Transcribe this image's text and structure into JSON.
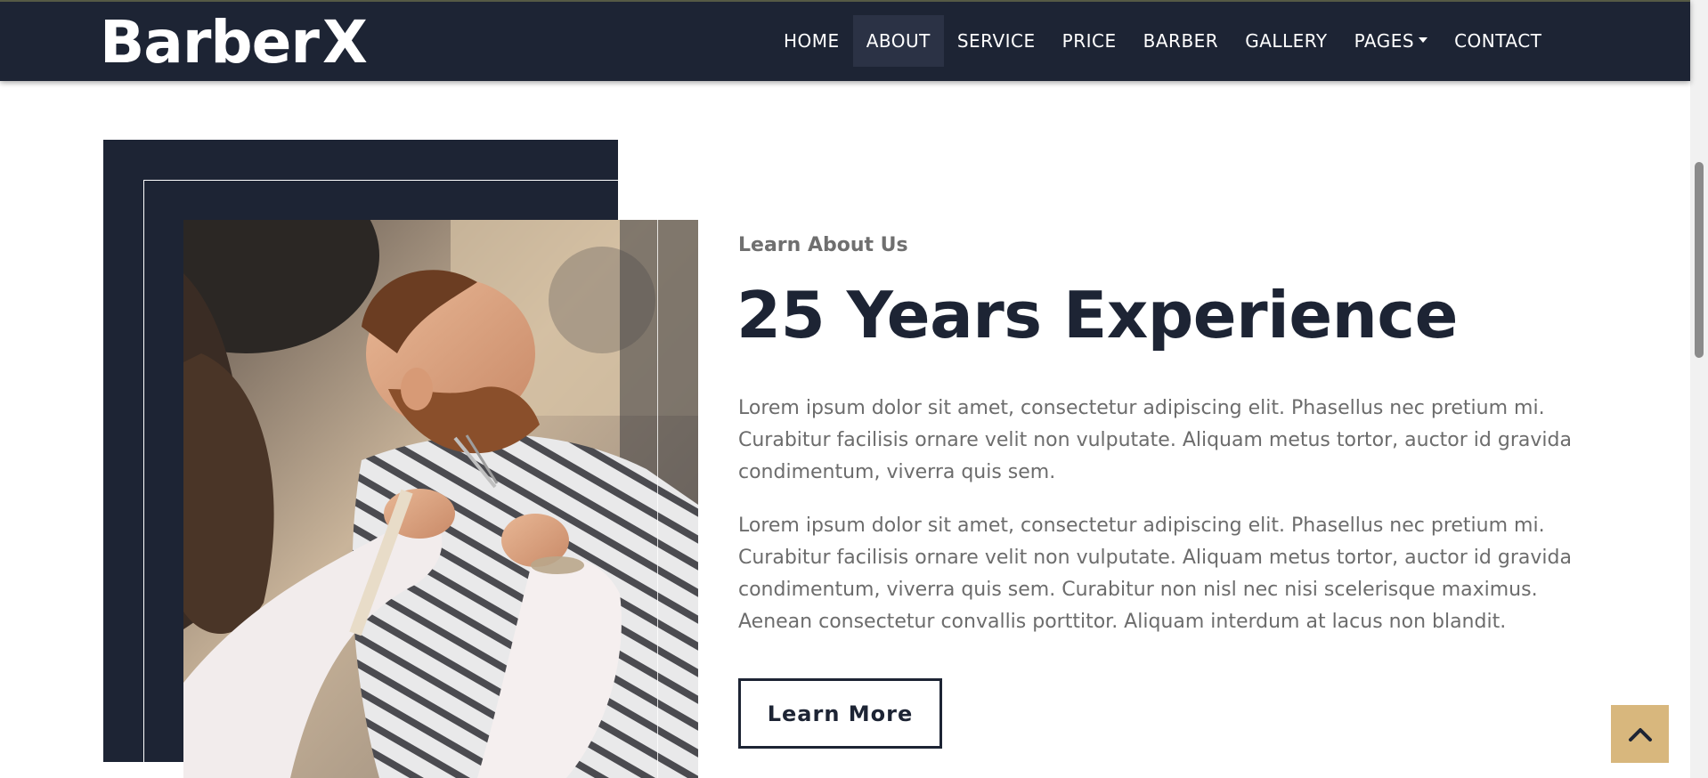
{
  "brand": {
    "name": "Barber",
    "mark": "X"
  },
  "nav": {
    "items": [
      {
        "label": "HOME"
      },
      {
        "label": "ABOUT"
      },
      {
        "label": "SERVICE"
      },
      {
        "label": "PRICE"
      },
      {
        "label": "BARBER"
      },
      {
        "label": "GALLERY"
      },
      {
        "label": "PAGES"
      },
      {
        "label": "CONTACT"
      }
    ],
    "active": "ABOUT"
  },
  "about": {
    "eyebrow": "Learn About Us",
    "heading": "25 Years Experience",
    "paragraphs": [
      "Lorem ipsum dolor sit amet, consectetur adipiscing elit. Phasellus nec pretium mi. Curabitur facilisis ornare velit non vulputate. Aliquam metus tortor, auctor id gravida condimentum, viverra quis sem.",
      "Lorem ipsum dolor sit amet, consectetur adipiscing elit. Phasellus nec pretium mi. Curabitur facilisis ornare velit non vulputate. Aliquam metus tortor, auctor id gravida condimentum, viverra quis sem. Curabitur non nisl nec nisi scelerisque maximus. Aenean consectetur convallis porttitor. Aliquam interdum at lacus non blandit."
    ],
    "button_label": "Learn More"
  },
  "icons": {
    "back_to_top": "chevron-up-icon",
    "dropdown": "caret-down-icon"
  },
  "colors": {
    "navy": "#1d2434",
    "accent_gold": "#d8b77d",
    "body_text": "#6c6c6c"
  }
}
